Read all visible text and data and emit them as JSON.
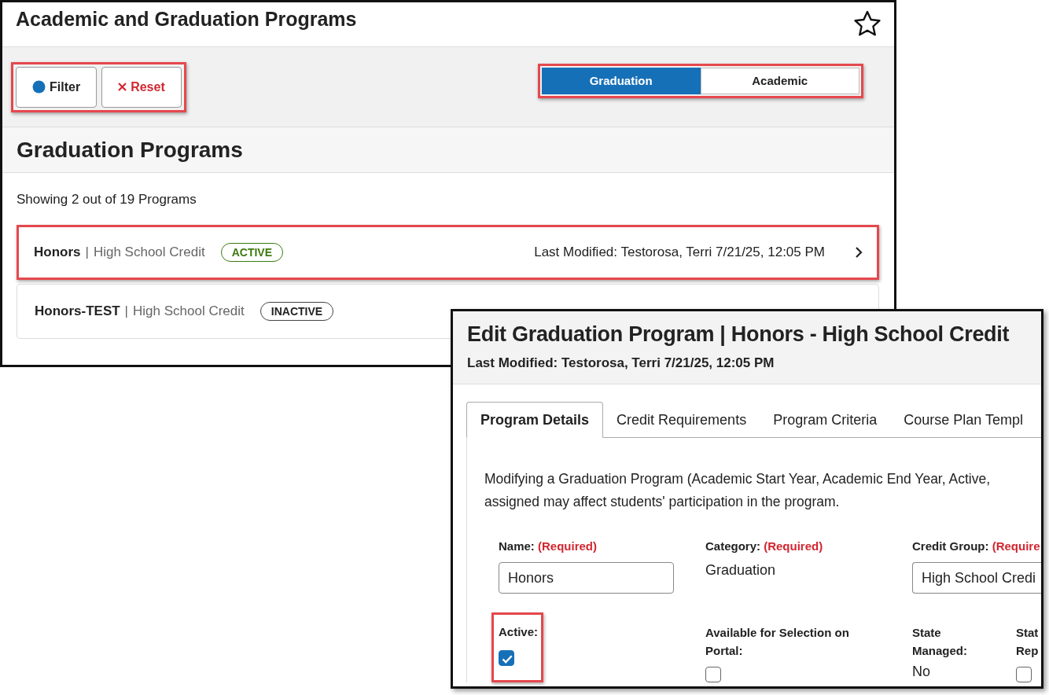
{
  "list_window": {
    "title": "Academic and Graduation Programs",
    "filter_highlighted": true,
    "filter_button": "Filter",
    "reset_button": "Reset",
    "toggle_highlighted": true,
    "view_toggle": [
      {
        "label": "Graduation",
        "selected": true
      },
      {
        "label": "Academic",
        "selected": false
      }
    ],
    "section_title": "Graduation Programs",
    "count_text": "Showing 2 out of 19 Programs",
    "programs": [
      {
        "name": "Honors",
        "separator": "|",
        "credit": "High School Credit",
        "status": "ACTIVE",
        "active": true,
        "last_modified": "Last Modified: Testorosa, Terri 7/21/25, 12:05 PM",
        "highlighted": true
      },
      {
        "name": "Honors-TEST",
        "separator": "|",
        "credit": "High School Credit",
        "status": "INACTIVE",
        "active": false,
        "highlighted": false
      }
    ]
  },
  "edit_window": {
    "title": "Edit Graduation Program | Honors - High School Credit",
    "last_modified": "Last Modified: Testorosa, Terri 7/21/25, 12:05 PM",
    "tabs": [
      {
        "label": "Program Details",
        "selected": true
      },
      {
        "label": "Credit Requirements",
        "selected": false
      },
      {
        "label": "Program Criteria",
        "selected": false
      },
      {
        "label": "Course Plan Templ",
        "selected": false
      }
    ],
    "description_lines": [
      "Modifying a Graduation Program (Academic Start Year, Academic End Year, Active,",
      "assigned may affect students' participation in the program."
    ],
    "fields": [
      {
        "kind": "text",
        "label": "Name:",
        "required": "(Required)",
        "value": "Honors"
      },
      {
        "kind": "static",
        "label": "Category:",
        "required": "(Required)",
        "value": "Graduation"
      },
      {
        "kind": "select",
        "label": "Credit Group:",
        "required": "(Require",
        "value": "High School Credi"
      },
      {
        "kind": "checkbox",
        "label": "Active:",
        "checked": true,
        "highlighted": true
      },
      {
        "kind": "checkbox",
        "label": "Available for Selection on Portal:",
        "checked": false
      },
      {
        "kind": "static",
        "label": "State Managed:",
        "value": "No"
      },
      {
        "kind": "checkbox",
        "label": "Stat Rep",
        "checked": false
      }
    ]
  }
}
